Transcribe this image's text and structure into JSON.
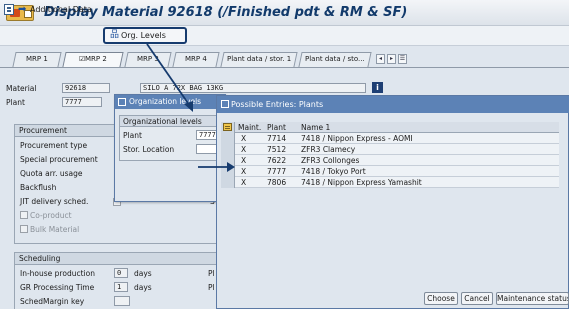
{
  "window": {
    "title": "Display Material 92618 (/Finished pdt & RM & SF)"
  },
  "toolbar": {
    "additional_data": "Additional Data",
    "org_levels": "Org. Levels"
  },
  "tabs": [
    {
      "label": "MRP 1"
    },
    {
      "label": "MRP 2"
    },
    {
      "label": "MRP 3"
    },
    {
      "label": "MRP 4"
    },
    {
      "label": "Plant data / stor. 1"
    },
    {
      "label": "Plant data / sto..."
    }
  ],
  "header": {
    "material_label": "Material",
    "material_value": "92618",
    "material_desc": "SILO A 72X BAG 13KG",
    "plant_label": "Plant",
    "plant_value": "7777"
  },
  "procurement": {
    "title": "Procurement",
    "fields": [
      "Procurement type",
      "Special procurement",
      "Quota arr. usage",
      "Backflush",
      "JIT delivery sched."
    ],
    "co_product": "Co-product",
    "bulk_material": "Bulk Material"
  },
  "scheduling": {
    "title": "Scheduling",
    "inhouse_label": "In-house production",
    "inhouse_value": "0",
    "inhouse_unit": "days",
    "gr_label": "GR Processing Time",
    "gr_value": "1",
    "gr_unit": "days",
    "schedmargin_label": "SchedMargin key",
    "right_p1": "Pl",
    "right_p2": "Pl"
  },
  "org_dialog": {
    "title": "Organization levels",
    "group_title": "Organizational levels",
    "plant_label": "Plant",
    "plant_value": "7777",
    "storloc_label": "Stor. Location",
    "storloc_value": ""
  },
  "possible_entries": {
    "title": "Possible Entries: Plants",
    "columns": [
      "Maint.",
      "Plant",
      "Name 1"
    ],
    "rows": [
      {
        "maint": "X",
        "plant": "7714",
        "name": "7418 / Nippon Express - AOMI"
      },
      {
        "maint": "X",
        "plant": "7512",
        "name": "ZFR3 Clamecy"
      },
      {
        "maint": "X",
        "plant": "7622",
        "name": "ZFR3 Collonges"
      },
      {
        "maint": "X",
        "plant": "7777",
        "name": "7418 / Tokyo Port"
      },
      {
        "maint": "X",
        "plant": "7806",
        "name": "7418 / Nippon Express Yamashit"
      }
    ],
    "buttons": {
      "choose": "Choose",
      "cancel": "Cancel",
      "maintenance": "Maintenance status"
    }
  },
  "colors": {
    "title_text": "#123a6b",
    "dialog_title_bg": "#5c82b6",
    "annotation": "#163b6e"
  },
  "icons": [
    "sap-menu-icon",
    "context-icon",
    "arrow-right-icon",
    "org-hierarchy-icon",
    "info-icon",
    "table-settings-icon"
  ]
}
